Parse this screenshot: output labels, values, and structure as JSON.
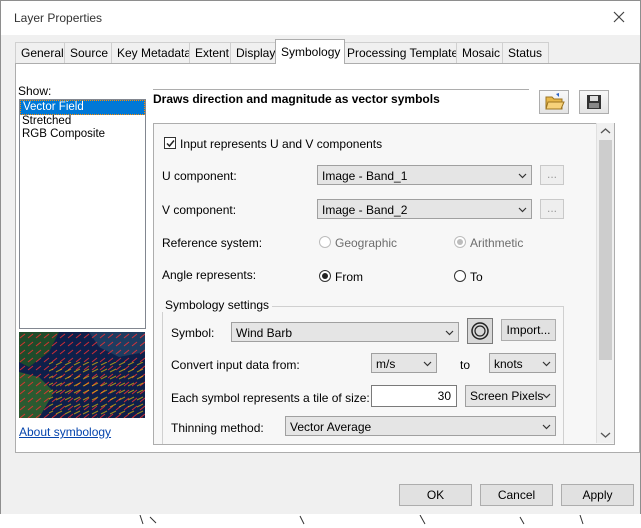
{
  "window": {
    "title": "Layer Properties"
  },
  "tabs": [
    {
      "label": "General"
    },
    {
      "label": "Source"
    },
    {
      "label": "Key Metadata"
    },
    {
      "label": "Extent"
    },
    {
      "label": "Display"
    },
    {
      "label": "Symbology",
      "active": true
    },
    {
      "label": "Processing Templates"
    },
    {
      "label": "Mosaic"
    },
    {
      "label": "Status"
    }
  ],
  "show": {
    "label": "Show:",
    "items": [
      "Vector Field",
      "Stretched",
      "RGB Composite"
    ],
    "selected": "Vector Field"
  },
  "about_link": "About symbology",
  "description": "Draws direction and magnitude as vector symbols",
  "settings": {
    "uv_checkbox_label": "Input represents U and V components",
    "uv_checked": true,
    "u_label": "U component:",
    "u_value": "Image - Band_1",
    "v_label": "V component:",
    "v_value": "Image - Band_2",
    "ellipsis": "...",
    "refsys_label": "Reference system:",
    "refsys_opt1": "Geographic",
    "refsys_opt2": "Arithmetic",
    "angle_label": "Angle represents:",
    "angle_opt1": "From",
    "angle_opt2": "To"
  },
  "symbology": {
    "group_label": "Symbology settings",
    "symbol_label": "Symbol:",
    "symbol_value": "Wind Barb",
    "import_label": "Import...",
    "convert_label": "Convert input data from:",
    "from_unit": "m/s",
    "to_label": "to",
    "to_unit": "knots",
    "tile_label": "Each symbol represents a tile of size:",
    "tile_value": "30",
    "tile_unit": "Screen Pixels",
    "thinning_label": "Thinning method:",
    "thinning_value": "Vector Average"
  },
  "buttons": {
    "ok": "OK",
    "cancel": "Cancel",
    "apply": "Apply"
  }
}
